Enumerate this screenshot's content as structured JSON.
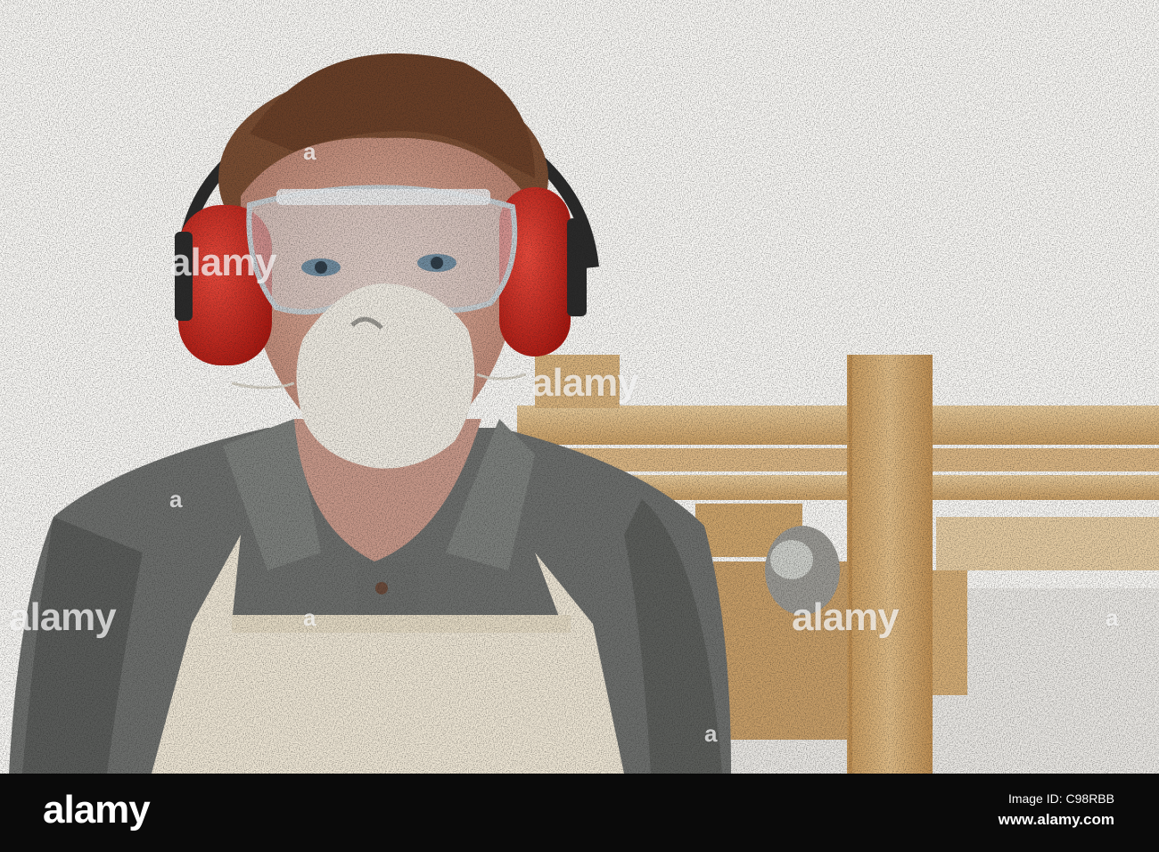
{
  "watermark": {
    "word": "alamy",
    "letter": "a"
  },
  "footer": {
    "logo": "alamy",
    "image_id": "Image ID: C98RBB",
    "url": "www.alamy.com"
  },
  "colors": {
    "footer_bg": "#0a0a0a",
    "ear_defenders": "#d42a22",
    "shirt": "#6d6f6d",
    "apron": "#efe7d6",
    "wood": "#d9b47c"
  },
  "scene": {
    "subject": "man-wearing-safety-goggles-ear-defenders-dust-mask-and-apron",
    "background": "workshop-with-wooden-beams"
  }
}
